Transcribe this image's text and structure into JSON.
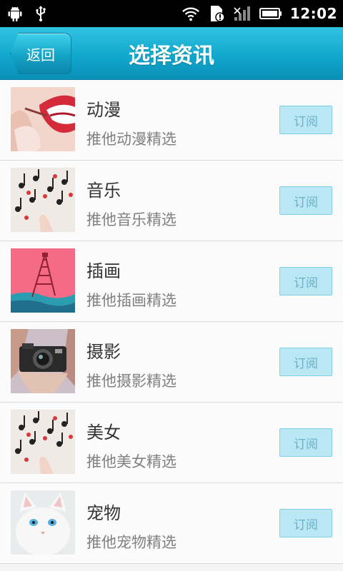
{
  "status_bar": {
    "time": "12:02",
    "icons": [
      "android-debug-icon",
      "usb-icon",
      "wifi-icon",
      "sim-alert-icon",
      "signal-icon",
      "battery-icon"
    ]
  },
  "header": {
    "back_label": "返回",
    "title": "选择资讯"
  },
  "items": [
    {
      "title": "动漫",
      "subtitle": "推他动漫精选",
      "button": "订阅"
    },
    {
      "title": "音乐",
      "subtitle": "推他音乐精选",
      "button": "订阅"
    },
    {
      "title": "插画",
      "subtitle": "推他插画精选",
      "button": "订阅"
    },
    {
      "title": "摄影",
      "subtitle": "推他摄影精选",
      "button": "订阅"
    },
    {
      "title": "美女",
      "subtitle": "推他美女精选",
      "button": "订阅"
    },
    {
      "title": "宠物",
      "subtitle": "推他宠物精选",
      "button": "订阅"
    }
  ],
  "colors": {
    "header": "#11a8cd",
    "button_bg": "#b9e8f4",
    "button_text": "#6ab0c8"
  }
}
